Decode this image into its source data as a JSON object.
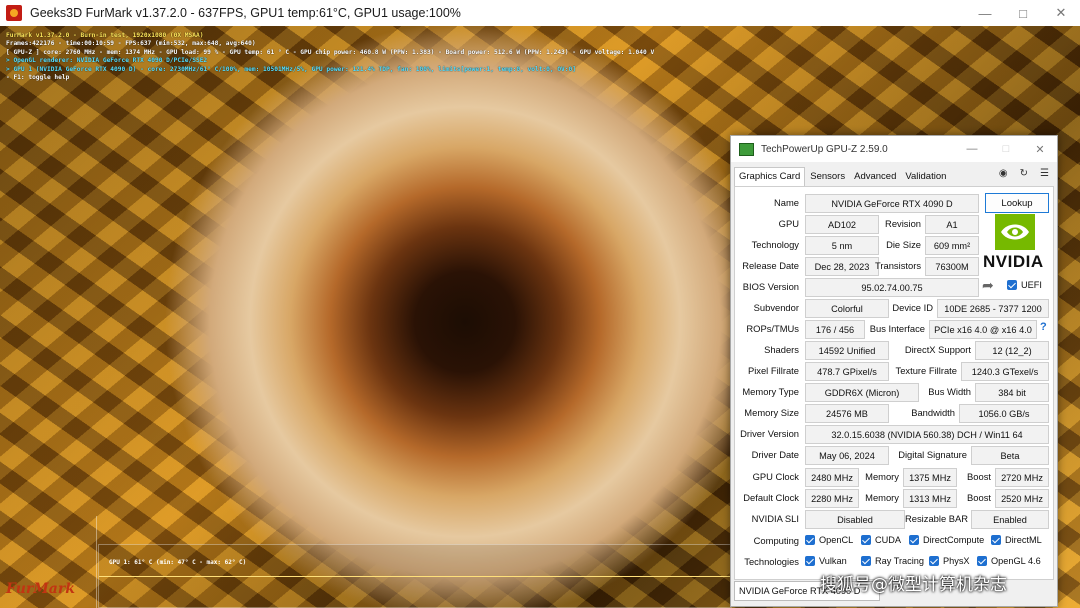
{
  "furmark": {
    "title": "Geeks3D FurMark v1.37.2.0 - 637FPS, GPU1 temp:61°C, GPU1 usage:100%",
    "overlay": [
      "FurMark v1.37.2.0 - Burn-in test, 1920x1080 (0X MSAA)",
      "Frames:422176 - time:00:10:59 - FPS:637 (min:532, max:648, avg:640)",
      "[ GPU-Z ] core: 2760 MHz - mem: 1374 MHz - GPU load: 99 % - GPU temp: 61 ° C - GPU chip power: 460.8 W (PPW: 1.383) - Board power: 512.6 W (PPW: 1.243) - GPU voltage: 1.040 V",
      "> OpenGL renderer: NVIDIA GeForce RTX 4090 D/PCIe/SSE2",
      "> GPU 1 (NVIDIA GeForce RTX 4090 D) - core: 2730MHz/61° C/100%, mem: 10501MHz/5%, GPU power: 121.4% TDP, fan: 100%, limits[power:1, temp:0, volt:0, OV:0]",
      "- F1: toggle help"
    ],
    "graph_label": "GPU 1: 61° C (min: 47° C - max: 62° C)",
    "logo": "FurMark"
  },
  "gpuz": {
    "title": "TechPowerUp GPU-Z 2.59.0",
    "tabs": [
      "Graphics Card",
      "Sensors",
      "Advanced",
      "Validation"
    ],
    "icons": [
      "camera-icon",
      "refresh-icon",
      "menu-icon"
    ],
    "name_label": "Name",
    "name_value": "NVIDIA GeForce RTX 4090 D",
    "lookup_label": "Lookup",
    "gpu_label": "GPU",
    "gpu_value": "AD102",
    "revision_label": "Revision",
    "revision_value": "A1",
    "technology_label": "Technology",
    "technology_value": "5 nm",
    "die_size_label": "Die Size",
    "die_size_value": "609 mm²",
    "release_date_label": "Release Date",
    "release_date_value": "Dec 28, 2023",
    "transistors_label": "Transistors",
    "transistors_value": "76300M",
    "bios_label": "BIOS Version",
    "bios_value": "95.02.74.00.75",
    "uefi_label": "UEFI",
    "subvendor_label": "Subvendor",
    "subvendor_value": "Colorful",
    "device_id_label": "Device ID",
    "device_id_value": "10DE 2685 - 7377 1200",
    "rops_label": "ROPs/TMUs",
    "rops_value": "176 / 456",
    "bus_interface_label": "Bus Interface",
    "bus_interface_value": "PCIe x16 4.0 @ x16 4.0",
    "question_mark": "?",
    "shaders_label": "Shaders",
    "shaders_value": "14592 Unified",
    "directx_label": "DirectX Support",
    "directx_value": "12 (12_2)",
    "pixel_fill_label": "Pixel Fillrate",
    "pixel_fill_value": "478.7 GPixel/s",
    "texture_fill_label": "Texture Fillrate",
    "texture_fill_value": "1240.3 GTexel/s",
    "memory_type_label": "Memory Type",
    "memory_type_value": "GDDR6X (Micron)",
    "bus_width_label": "Bus Width",
    "bus_width_value": "384 bit",
    "memory_size_label": "Memory Size",
    "memory_size_value": "24576 MB",
    "bandwidth_label": "Bandwidth",
    "bandwidth_value": "1056.0 GB/s",
    "driver_version_label": "Driver Version",
    "driver_version_value": "32.0.15.6038 (NVIDIA 560.38) DCH / Win11 64",
    "driver_date_label": "Driver Date",
    "driver_date_value": "May 06, 2024",
    "digital_sig_label": "Digital Signature",
    "digital_sig_value": "Beta",
    "gpu_clock_label": "GPU Clock",
    "gpu_clock_value": "2480 MHz",
    "memory_label": "Memory",
    "memory_clock_value": "1375 MHz",
    "boost_label": "Boost",
    "boost_value": "2720 MHz",
    "default_clock_label": "Default Clock",
    "default_clock_value": "2280 MHz",
    "default_memory_value": "1313 MHz",
    "default_boost_value": "2520 MHz",
    "sli_label": "NVIDIA SLI",
    "sli_value": "Disabled",
    "rebar_label": "Resizable BAR",
    "rebar_value": "Enabled",
    "computing_label": "Computing",
    "computing": [
      "OpenCL",
      "CUDA",
      "DirectCompute",
      "DirectML"
    ],
    "technologies_label": "Technologies",
    "technologies": [
      "Vulkan",
      "Ray Tracing",
      "PhysX",
      "OpenGL 4.6"
    ],
    "bottom_select": "NVIDIA GeForce RTX 4090 D",
    "nvidia_logo": "NVIDIA"
  },
  "watermark": "搜狐号@微型计算机杂志"
}
